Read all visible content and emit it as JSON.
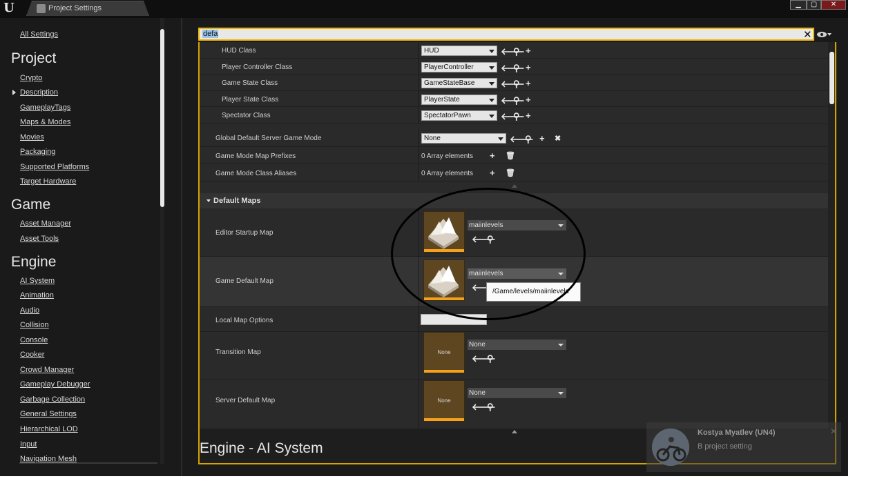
{
  "tab": {
    "title": "Project Settings"
  },
  "window": {
    "minimize": "▁",
    "maximize": "▢",
    "close": "✕"
  },
  "sidebar": {
    "all_settings": "All Settings",
    "project_heading": "Project",
    "project_items": [
      "Crypto",
      "Description",
      "GameplayTags",
      "Maps & Modes",
      "Movies",
      "Packaging",
      "Supported Platforms",
      "Target Hardware"
    ],
    "game_heading": "Game",
    "game_items": [
      "Asset Manager",
      "Asset Tools"
    ],
    "engine_heading": "Engine",
    "engine_items": [
      "AI System",
      "Animation",
      "Audio",
      "Collision",
      "Console",
      "Cooker",
      "Crowd Manager",
      "Gameplay Debugger",
      "Garbage Collection",
      "General Settings",
      "Hierarchical LOD",
      "Input",
      "Navigation Mesh"
    ]
  },
  "search": {
    "value": "defa",
    "clear_icon": "close-icon"
  },
  "class_rows": [
    {
      "label": "HUD Class",
      "value": "HUD"
    },
    {
      "label": "Player Controller Class",
      "value": "PlayerController"
    },
    {
      "label": "Game State Class",
      "value": "GameStateBase"
    },
    {
      "label": "Player State Class",
      "value": "PlayerState"
    },
    {
      "label": "Spectator Class",
      "value": "SpectatorPawn"
    }
  ],
  "global_mode": {
    "label": "Global Default Server Game Mode",
    "value": "None"
  },
  "prefixes": {
    "label": "Game Mode Map Prefixes",
    "value": "0 Array elements"
  },
  "aliases": {
    "label": "Game Mode Class Aliases",
    "value": "0 Array elements"
  },
  "default_maps": {
    "heading": "Default Maps",
    "editor_startup": {
      "label": "Editor Startup Map",
      "value": "maiinlevels"
    },
    "game_default": {
      "label": "Game Default Map",
      "value": "maiinlevels",
      "tooltip": "/Game/levels/maiinlevels"
    },
    "local_options": {
      "label": "Local Map Options"
    },
    "transition": {
      "label": "Transition Map",
      "value": "None",
      "thumb": "None"
    },
    "server_default": {
      "label": "Server Default Map",
      "value": "None",
      "thumb": "None"
    }
  },
  "engine_ai_title": "Engine - AI System",
  "toast": {
    "name": "Kostya Myatlev (UN4)",
    "message": "В project setting"
  }
}
